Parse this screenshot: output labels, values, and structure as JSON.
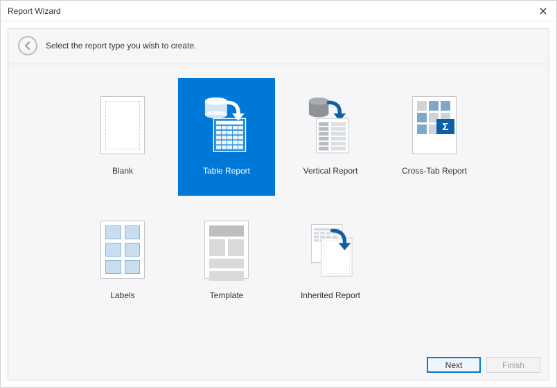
{
  "titlebar": {
    "title": "Report Wizard"
  },
  "header": {
    "instruction": "Select the report type you wish to create."
  },
  "options": {
    "blank": {
      "label": "Blank"
    },
    "table": {
      "label": "Table Report"
    },
    "vertical": {
      "label": "Vertical Report"
    },
    "crosstab": {
      "label": "Cross-Tab Report"
    },
    "labels": {
      "label": "Labels"
    },
    "template": {
      "label": "Template"
    },
    "inherited": {
      "label": "Inherited Report"
    }
  },
  "buttons": {
    "next": "Next",
    "finish": "Finish"
  },
  "state": {
    "selected": "table"
  }
}
